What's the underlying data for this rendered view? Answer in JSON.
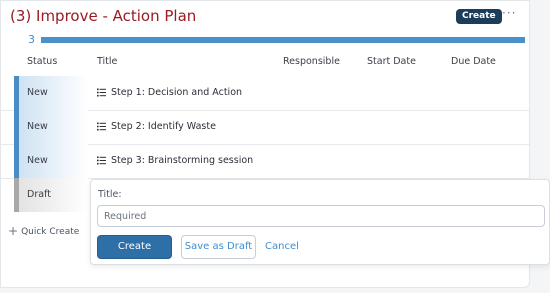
{
  "header": {
    "title": "(3) Improve - Action Plan",
    "create_label": "Create",
    "more_label": "···"
  },
  "progress": {
    "count": "3"
  },
  "columns": [
    "Status",
    "Title",
    "Responsible",
    "Start Date",
    "Due Date"
  ],
  "rows": [
    {
      "status": "New",
      "title": "Step 1: Decision and Action"
    },
    {
      "status": "New",
      "title": "Step 2: Identify Waste"
    },
    {
      "status": "New",
      "title": "Step 3: Brainstorming session"
    },
    {
      "status": "Draft",
      "title": ""
    }
  ],
  "quick_create": {
    "label": "Quick Create"
  },
  "form": {
    "title_label": "Title:",
    "title_placeholder": "Required",
    "title_value": "",
    "create_label": "Create",
    "save_draft_label": "Save as Draft",
    "cancel_label": "Cancel"
  },
  "colors": {
    "title": "#9b1b22",
    "accent": "#3f8ed1",
    "bar": "#4a90c9",
    "new_status": "#4a8cc7",
    "draft_status": "#a8a8a8",
    "primary_button": "#2f6fa8",
    "chip": "#1c3d5a"
  },
  "icons": {
    "row_icon": "list-icon",
    "quick_create_icon": "plus-icon",
    "more_icon": "ellipsis-icon"
  }
}
